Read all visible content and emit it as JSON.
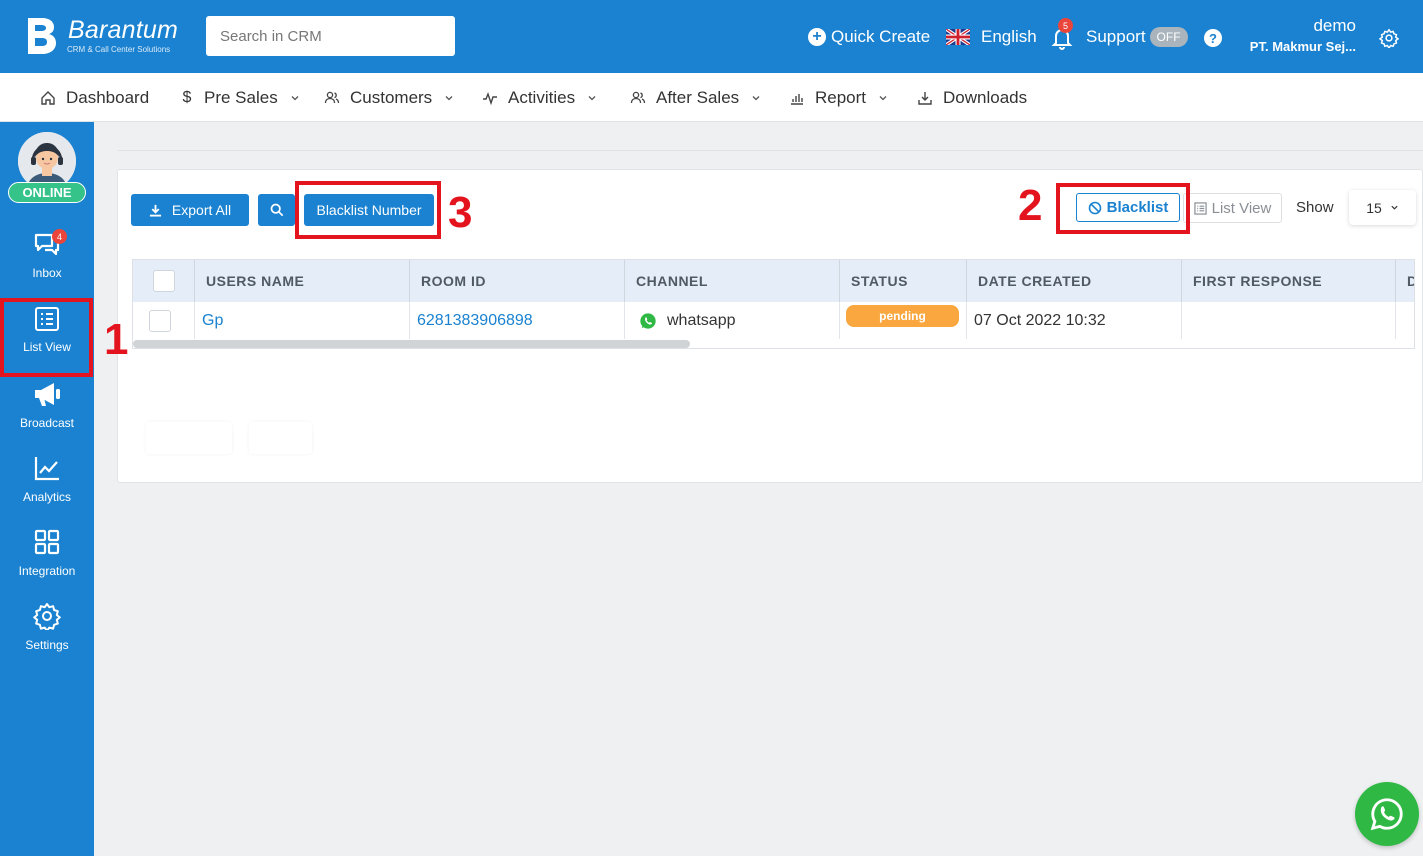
{
  "app": {
    "logo_name": "Barantum",
    "logo_tagline": "CRM & Call Center Solutions"
  },
  "header": {
    "search_placeholder": "Search in CRM",
    "quick_create": "Quick Create",
    "language": "English",
    "notification_count": "5",
    "support_label": "Support",
    "support_toggle": "OFF",
    "help": "?",
    "user_name": "demo",
    "user_company": "PT. Makmur Sej..."
  },
  "nav": {
    "items": [
      {
        "label": "Dashboard"
      },
      {
        "label": "Pre Sales"
      },
      {
        "label": "Customers"
      },
      {
        "label": "Activities"
      },
      {
        "label": "After Sales"
      },
      {
        "label": "Report"
      },
      {
        "label": "Downloads"
      }
    ]
  },
  "sidebar": {
    "status": "ONLINE",
    "inbox_count": "4",
    "items": [
      {
        "label": "Inbox"
      },
      {
        "label": "List View"
      },
      {
        "label": "Broadcast"
      },
      {
        "label": "Analytics"
      },
      {
        "label": "Integration"
      },
      {
        "label": "Settings"
      }
    ]
  },
  "toolbar": {
    "export_all": "Export All",
    "blacklist_number": "Blacklist Number",
    "blacklist": "Blacklist",
    "list_view": "List View",
    "show_label": "Show",
    "show_value": "15"
  },
  "table": {
    "columns": [
      "USERS NAME",
      "ROOM ID",
      "CHANNEL",
      "STATUS",
      "DATE CREATED",
      "FIRST RESPONSE",
      "D"
    ],
    "rows": [
      {
        "users_name": "Gp",
        "room_id": "6281383906898",
        "channel": "whatsapp",
        "status": "pending",
        "date_created": "07 Oct 2022 10:32",
        "first_response": ""
      }
    ]
  },
  "annotations": [
    "1",
    "2",
    "3"
  ],
  "colors": {
    "primary": "#1a82d0",
    "online": "#35c38a",
    "pending": "#f9a73e",
    "badge": "#e9453b",
    "highlight": "#e3141e",
    "whatsapp": "#2fb944"
  }
}
